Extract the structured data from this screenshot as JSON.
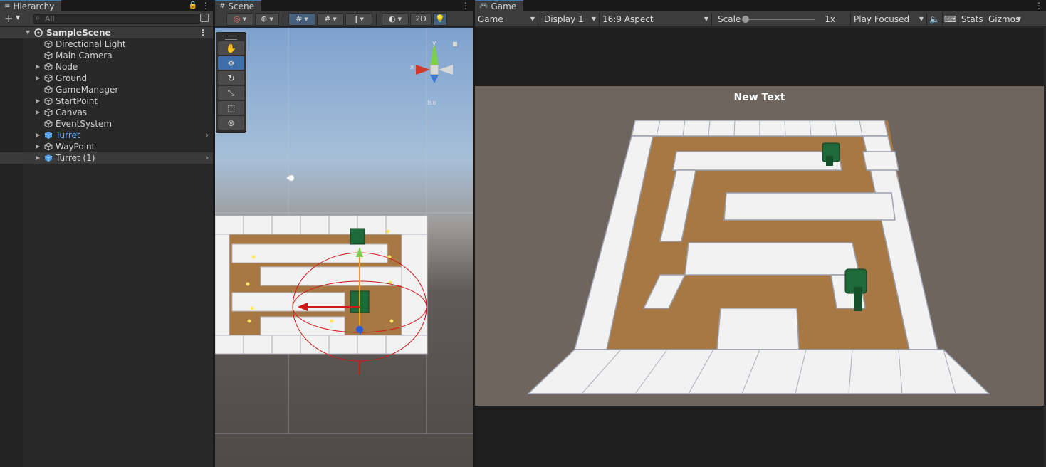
{
  "hierarchy": {
    "tab_label": "Hierarchy",
    "search_placeholder": "All",
    "add_label": "+",
    "scene_name": "SampleScene",
    "items": [
      {
        "label": "Directional Light"
      },
      {
        "label": "Main Camera"
      },
      {
        "label": "Node"
      },
      {
        "label": "Ground"
      },
      {
        "label": "GameManager"
      },
      {
        "label": "StartPoint"
      },
      {
        "label": "Canvas"
      },
      {
        "label": "EventSystem"
      },
      {
        "label": "Turret"
      },
      {
        "label": "WayPoint"
      },
      {
        "label": "Turret (1)"
      }
    ]
  },
  "scene": {
    "tab_label": "Scene",
    "toggle_2d": "2D",
    "gizmo_axis_x": "x",
    "gizmo_axis_y": "y",
    "view_mode": "Iso"
  },
  "game": {
    "tab_label": "Game",
    "mode": "Game",
    "display": "Display 1",
    "aspect": "16:9 Aspect",
    "scale_label": "Scale",
    "scale_value": "1x",
    "play_mode": "Play Focused",
    "stats": "Stats",
    "gizmos": "Gizmos",
    "ui_text": "New Text"
  },
  "colors": {
    "accent": "#3a79bb",
    "prefab": "#6aaeff",
    "path": "#a87844",
    "wall": "#f2f2f2",
    "ground": "#6e655f"
  }
}
